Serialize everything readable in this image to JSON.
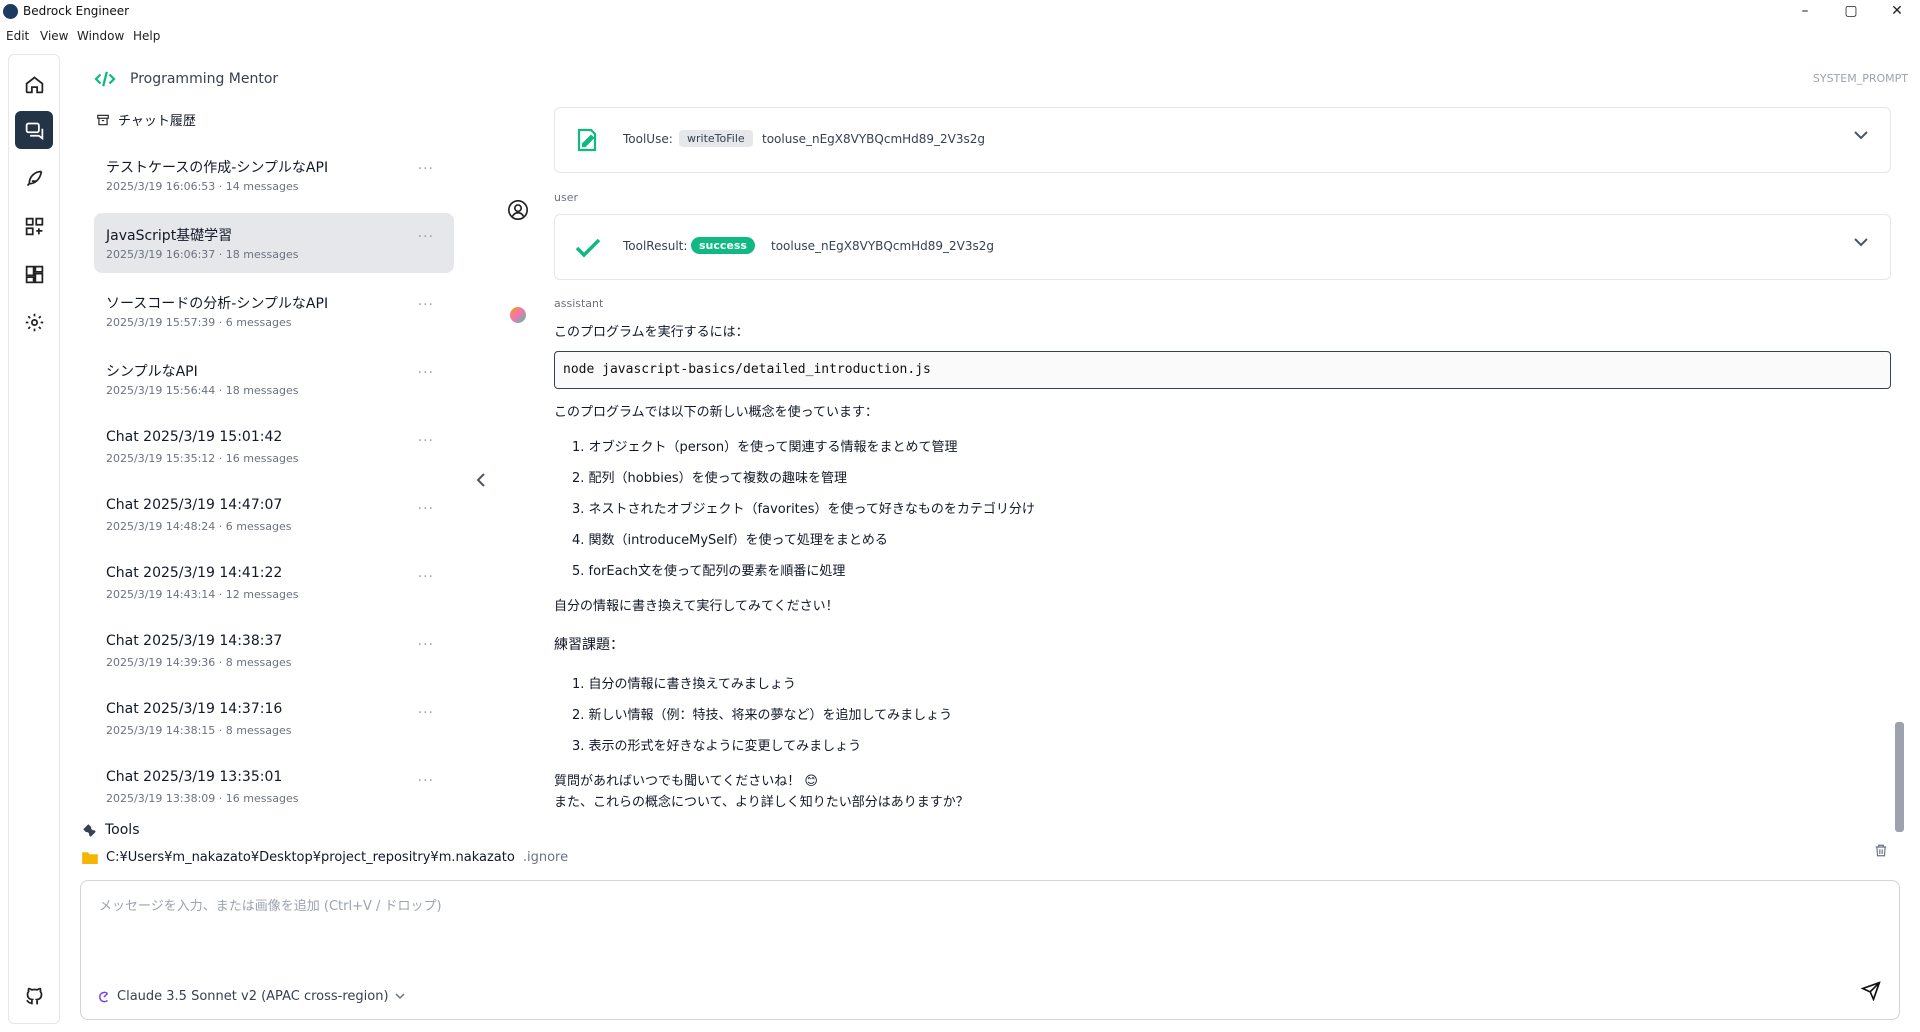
{
  "app": {
    "title": "Bedrock Engineer"
  },
  "window_controls": {
    "minimize": "–",
    "maximize": "▢",
    "close": "✕"
  },
  "menu": [
    "Edit",
    "View",
    "Window",
    "Help"
  ],
  "header": {
    "agent_name": "Programming Mentor",
    "system_prompt_label": "SYSTEM_PROMPT"
  },
  "sidebar": {
    "history_label": "チャット履歴",
    "more_label": "···",
    "chats": [
      {
        "title": "テストケースの作成-シンプルなAPI",
        "meta": "2025/3/19 16:06:53 · 14 messages"
      },
      {
        "title": "JavaScript基礎学習",
        "meta": "2025/3/19 16:06:37 · 18 messages"
      },
      {
        "title": "ソースコードの分析-シンプルなAPI",
        "meta": "2025/3/19 15:57:39 · 6 messages"
      },
      {
        "title": "シンプルなAPI",
        "meta": "2025/3/19 15:56:44 · 18 messages"
      },
      {
        "title": "Chat 2025/3/19 15:01:42",
        "meta": "2025/3/19 15:35:12 · 16 messages"
      },
      {
        "title": "Chat 2025/3/19 14:47:07",
        "meta": "2025/3/19 14:48:24 · 6 messages"
      },
      {
        "title": "Chat 2025/3/19 14:41:22",
        "meta": "2025/3/19 14:43:14 · 12 messages"
      },
      {
        "title": "Chat 2025/3/19 14:38:37",
        "meta": "2025/3/19 14:39:36 · 8 messages"
      },
      {
        "title": "Chat 2025/3/19 14:37:16",
        "meta": "2025/3/19 14:38:15 · 8 messages"
      },
      {
        "title": "Chat 2025/3/19 13:35:01",
        "meta": "2025/3/19 13:38:09 · 16 messages"
      }
    ]
  },
  "messages": {
    "tool_use": {
      "label": "ToolUse:",
      "badge": "writeToFile",
      "id": "tooluse_nEgX8VYBQcmHd89_2V3s2g"
    },
    "user_role": "user",
    "tool_result": {
      "label": "ToolResult:",
      "badge": "success",
      "id": "tooluse_nEgX8VYBQcmHd89_2V3s2g"
    },
    "assistant_role": "assistant",
    "intro": "このプログラムを実行するには：",
    "code": "node javascript-basics/detailed_introduction.js",
    "concepts_intro": "このプログラムでは以下の新しい概念を使っています：",
    "concepts": [
      "1. オブジェクト（person）を使って関連する情報をまとめて管理",
      "2. 配列（hobbies）を使って複数の趣味を管理",
      "3. ネストされたオブジェクト（favorites）を使って好きなものをカテゴリ分け",
      "4. 関数（introduceMySelf）を使って処理をまとめる",
      "5. forEach文を使って配列の要素を順番に処理"
    ],
    "try_it": "自分の情報に書き換えて実行してみてください！",
    "exercise_title": "練習課題：",
    "exercises": [
      "1. 自分の情報に書き換えてみましょう",
      "2. 新しい情報（例：特技、将来の夢など）を追加してみましょう",
      "3. 表示の形式を好きなように変更してみましょう"
    ],
    "closing_1": "質問があればいつでも聞いてくださいね！ 😊",
    "closing_2": "また、これらの概念について、より詳しく知りたい部分はありますか？"
  },
  "bottom": {
    "tools_label": "Tools",
    "path": "C:¥Users¥m_nakazato¥Desktop¥project_repositry¥m.nakazato",
    "ignore_label": ".ignore"
  },
  "input": {
    "placeholder": "メッセージを入力、または画像を追加 (Ctrl+V / ドロップ)",
    "model": "Claude 3.5 Sonnet v2 (APAC cross-region)"
  },
  "colors": {
    "accent": "#10b981",
    "rail_active": "#243447"
  }
}
